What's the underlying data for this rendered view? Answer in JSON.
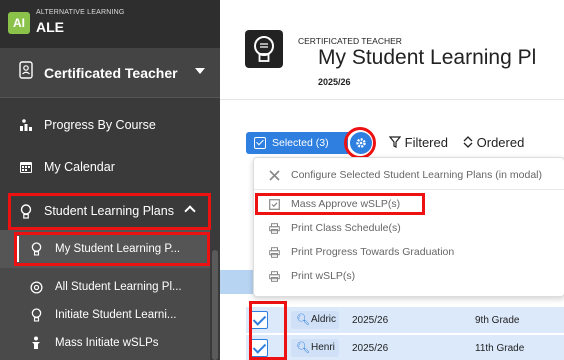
{
  "brand": {
    "logo": "AI",
    "subtitle": "ALTERNATIVE LEARNING",
    "name": "ALE"
  },
  "sidebar": {
    "role": "Certificated Teacher",
    "items": [
      {
        "label": "Progress By Course",
        "icon": "chart-icon"
      },
      {
        "label": "My Calendar",
        "icon": "calendar-icon"
      },
      {
        "label": "Student Learning Plans",
        "icon": "bulb-icon"
      },
      {
        "label": "My Student Learning P...",
        "icon": "bulb-icon"
      },
      {
        "label": "All Student Learning Pl...",
        "icon": "at-icon"
      },
      {
        "label": "Initiate Student Learni...",
        "icon": "bulb-icon"
      },
      {
        "label": "Mass Initiate wSLPs",
        "icon": "person-icon"
      }
    ]
  },
  "header": {
    "eyebrow": "CERTIFICATED TEACHER",
    "title": "My Student Learning Pl",
    "year": "2025/26"
  },
  "toolbar": {
    "selected": "Selected (3)",
    "filtered": "Filtered",
    "ordered": "Ordered"
  },
  "menu": {
    "items": [
      {
        "label": "Configure Selected Student Learning Plans (in modal)",
        "icon": "tools-icon"
      },
      {
        "label": "Mass Approve wSLP(s)",
        "icon": "checkbox-icon"
      },
      {
        "label": "Print Class Schedule(s)",
        "icon": "print-icon"
      },
      {
        "label": "Print Progress Towards Graduation",
        "icon": "print-icon"
      },
      {
        "label": "Print wSLP(s)",
        "icon": "print-icon"
      }
    ]
  },
  "rows": [
    {
      "name": "Aldric",
      "year": "2025/26",
      "grade": "9th Grade"
    },
    {
      "name": "Henri",
      "year": "2025/26",
      "grade": "11th Grade"
    }
  ],
  "colors": {
    "accent": "#2f7fe0",
    "highlight": "#ee1111",
    "sidebar": "#3a3a3a"
  }
}
